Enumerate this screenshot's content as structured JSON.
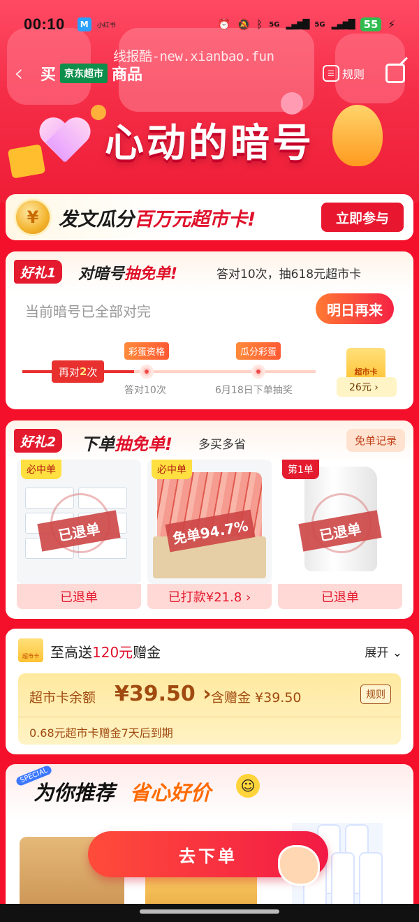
{
  "status_bar": {
    "time": "00:10",
    "app_icon_label": "M",
    "small_label": "小红书",
    "network_1": "5G",
    "network_2": "5G",
    "battery": "55"
  },
  "nav": {
    "buy": "买",
    "brand_badge": "京东超市",
    "goods": "商品",
    "rules_label": "规则",
    "watermark": "线报酷-new.xianbao.fun"
  },
  "hero": {
    "title": "心动的暗号"
  },
  "promo": {
    "coin": "¥",
    "text_black": "发文瓜分",
    "text_red": "百万元超市卡!",
    "button": "立即参与"
  },
  "gift1": {
    "tag": "好礼1",
    "title_black": "对暗号",
    "title_red": "抽免单!",
    "subtitle": "答对10次，抽618元超市卡",
    "current": "当前暗号已全部对完",
    "button": "明日再来",
    "progress_prefix": "再对",
    "progress_count": "2",
    "progress_suffix": "次",
    "step1_tag": "彩蛋资格",
    "step1_label": "答对10次",
    "step2_tag": "瓜分彩蛋",
    "step2_label": "6月18日下单抽奖",
    "card_label": "超市卡",
    "card_amount": "26元 ›"
  },
  "gift2": {
    "tag": "好礼2",
    "title_black": "下单",
    "title_red": "抽免单!",
    "subtitle": "多买多省",
    "records": "免单记录",
    "products": [
      {
        "corner": "必中单",
        "stamp": "已退单",
        "bottom": "已退单"
      },
      {
        "corner": "必中单",
        "stamp": "免单94.7%",
        "bottom": "已打款¥21.8 ›"
      },
      {
        "corner": "第1单",
        "stamp": "已退单",
        "bottom": "已退单"
      }
    ]
  },
  "card_balance": {
    "icon_label": "超市卡",
    "title_prefix": "至高送",
    "title_red": "120元",
    "title_suffix": "赠金",
    "expand": "展开 ⌄",
    "balance_label": "超市卡余额",
    "balance_amount": "¥39.50 ›",
    "gift_label": "含赠金 ¥39.50",
    "rules": "规则",
    "expiry": "0.68元超市卡赠金7天后到期"
  },
  "recommend": {
    "special": "SPECIAL",
    "title_black": "为你推荐",
    "title_orange": "省心好价",
    "smile": "☺"
  },
  "cta": {
    "label": "去下单"
  }
}
